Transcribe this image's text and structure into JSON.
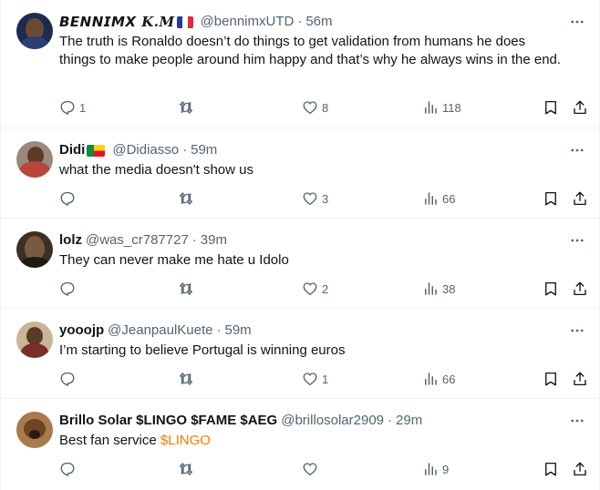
{
  "tweets": [
    {
      "name": "𝘽𝙀𝙉𝙉𝙄𝙈𝙓 K.M",
      "flag": "france",
      "handle": "@bennimxUTD",
      "dot": "·",
      "time": "56m",
      "text": "The truth is Ronaldo doesn’t do things to get validation from humans he does things to make people around him happy and that’s why he always wins in the end.",
      "replies": "1",
      "retweets": "",
      "likes": "8",
      "views": "118"
    },
    {
      "name": "Didi",
      "flag": "benin",
      "handle": "@Didiasso",
      "dot": "·",
      "time": "59m",
      "text": "what the media doesn't show us",
      "replies": "",
      "retweets": "",
      "likes": "3",
      "views": "66"
    },
    {
      "name": "lolz",
      "handle": "@was_cr787727",
      "dot": "·",
      "time": "39m",
      "text": "They can never make me hate u Idolo",
      "replies": "",
      "retweets": "",
      "likes": "2",
      "views": "38"
    },
    {
      "name": "yooojp",
      "handle": "@JeanpaulKuete",
      "dot": "·",
      "time": "59m",
      "text": "I’m starting to believe Portugal is winning euros",
      "replies": "",
      "retweets": "",
      "likes": "1",
      "views": "66"
    },
    {
      "name": "Brillo Solar $LINGO $FAME $AEG",
      "handle": "@brillosolar2909",
      "dot": "·",
      "time": "29m",
      "text": "Best fan service ",
      "cashtag": "$LINGO",
      "replies": "",
      "retweets": "",
      "likes": "",
      "views": "9"
    }
  ],
  "colors": {
    "text": "#0f1419",
    "secondary": "#536471",
    "cashtag": "#ff7a00",
    "divider": "#eff3f4"
  },
  "icons": [
    "reply-icon",
    "retweet-icon",
    "like-icon",
    "views-icon",
    "bookmark-icon",
    "share-icon",
    "more-icon"
  ]
}
